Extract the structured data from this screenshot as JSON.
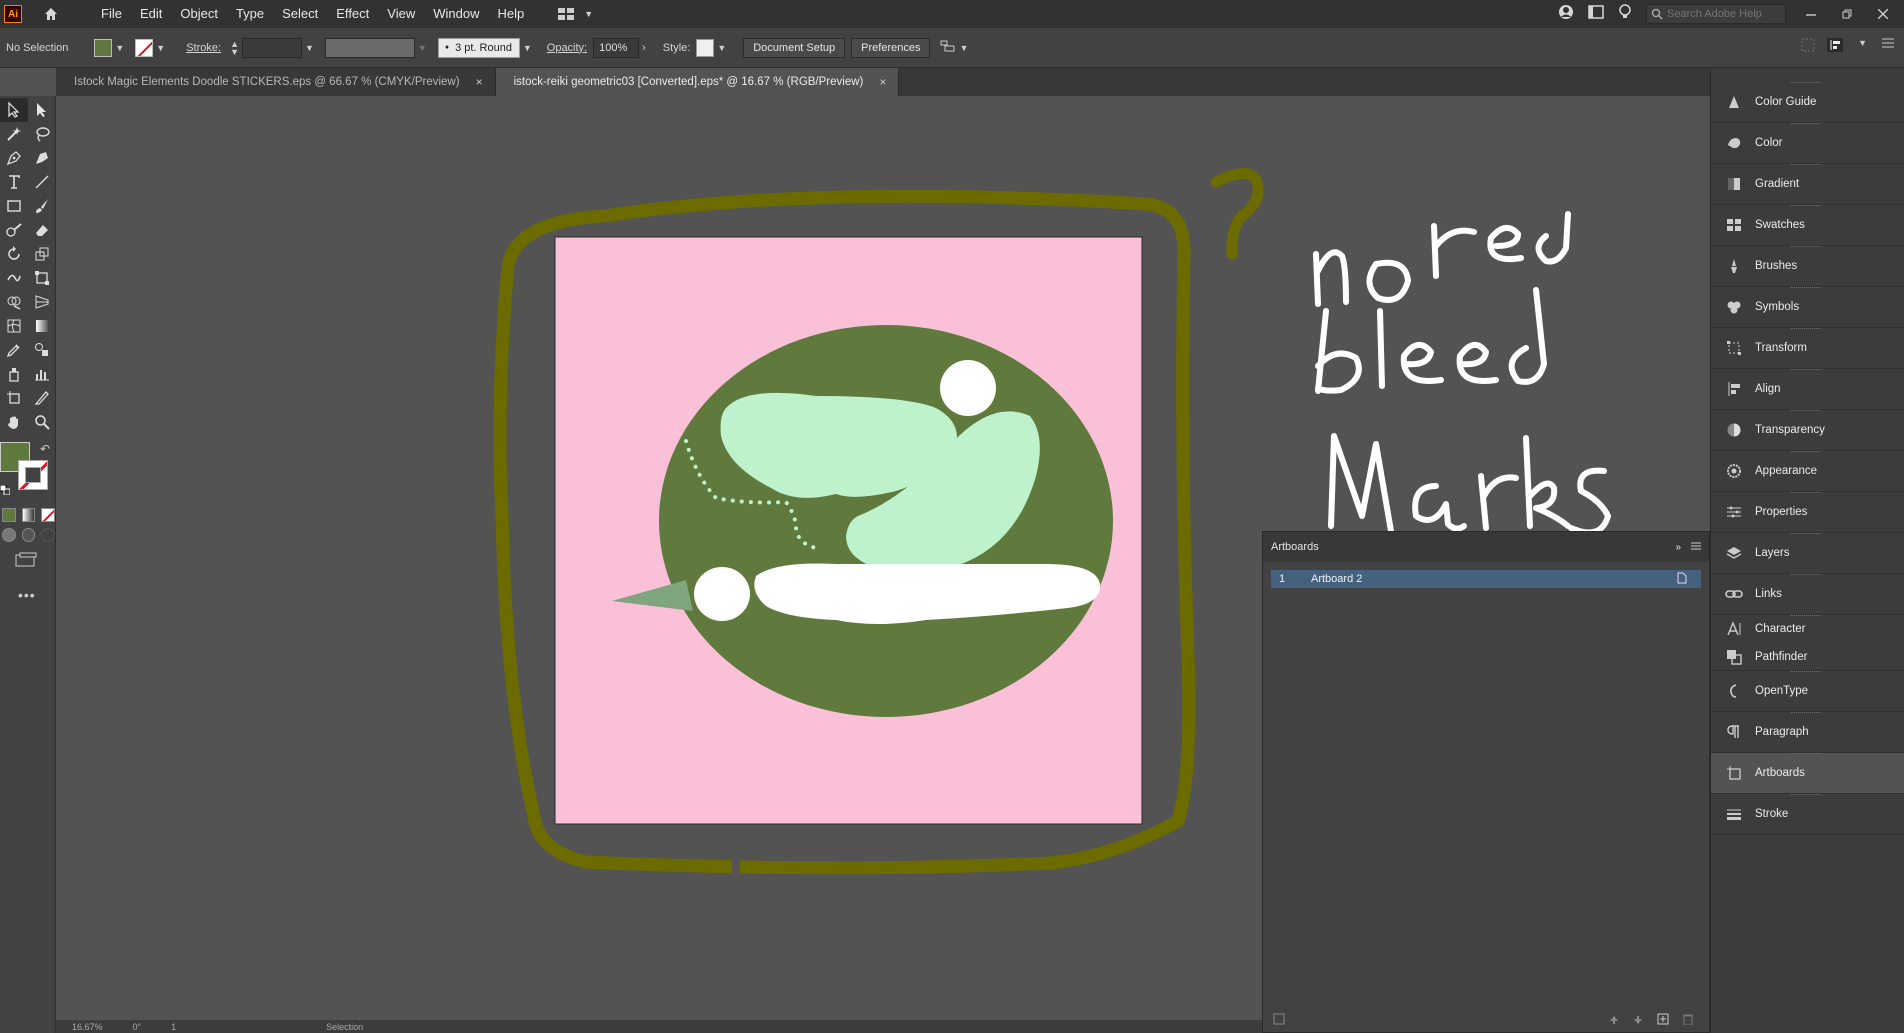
{
  "app": {
    "logo_text": "Ai",
    "menu": [
      "File",
      "Edit",
      "Object",
      "Type",
      "Select",
      "Effect",
      "View",
      "Window",
      "Help"
    ],
    "search_placeholder": "Search Adobe Help"
  },
  "control": {
    "selection_label": "No Selection",
    "stroke_label": "Stroke:",
    "brush_label": "3 pt. Round",
    "opacity_label": "Opacity:",
    "opacity_value": "100%",
    "style_label": "Style:",
    "document_setup": "Document Setup",
    "preferences": "Preferences"
  },
  "tabs": [
    {
      "label": "Istock Magic Elements Doodle STICKERS.eps @ 66.67 % (CMYK/Preview)",
      "close": "×"
    },
    {
      "label": "istock-reiki geometric03 [Converted].eps* @ 16.67 % (RGB/Preview)",
      "close": "×"
    }
  ],
  "dock": {
    "items": [
      {
        "label": "Color Guide",
        "icon": "color-guide-icon"
      },
      {
        "label": "Color",
        "icon": "color-icon"
      },
      {
        "label": "Gradient",
        "icon": "gradient-icon"
      },
      {
        "label": "Swatches",
        "icon": "swatches-icon"
      },
      {
        "label": "Brushes",
        "icon": "brushes-icon"
      },
      {
        "label": "Symbols",
        "icon": "symbols-icon"
      },
      {
        "label": "Transform",
        "icon": "transform-icon"
      },
      {
        "label": "Align",
        "icon": "align-icon"
      },
      {
        "label": "Transparency",
        "icon": "transparency-icon"
      },
      {
        "label": "Appearance",
        "icon": "appearance-icon"
      },
      {
        "label": "Properties",
        "icon": "properties-icon"
      },
      {
        "label": "Layers",
        "icon": "layers-icon"
      },
      {
        "label": "Links",
        "icon": "links-icon"
      },
      {
        "label": "Character",
        "icon": "character-icon"
      },
      {
        "label": "Pathfinder",
        "icon": "pathfinder-icon"
      },
      {
        "label": "OpenType",
        "icon": "opentype-icon"
      },
      {
        "label": "Paragraph",
        "icon": "paragraph-icon"
      },
      {
        "label": "Artboards",
        "icon": "artboards-icon"
      },
      {
        "label": "Stroke",
        "icon": "stroke-icon"
      }
    ]
  },
  "artboards_panel": {
    "title": "Artboards",
    "rows": [
      {
        "num": "1",
        "name": "Artboard 2"
      }
    ]
  },
  "status": {
    "zoom": "16.67%",
    "angle": "0°",
    "artboard_index": "1",
    "tool": "Selection"
  },
  "annotation": {
    "note": "no red bleed marks",
    "question": "?"
  },
  "colors": {
    "artboard_bg": "#f9c0d8",
    "blob_dark": "#5f7a3c",
    "blob_light": "#bdf2cd",
    "white": "#ffffff",
    "annotation_olive": "#6b6b00"
  }
}
